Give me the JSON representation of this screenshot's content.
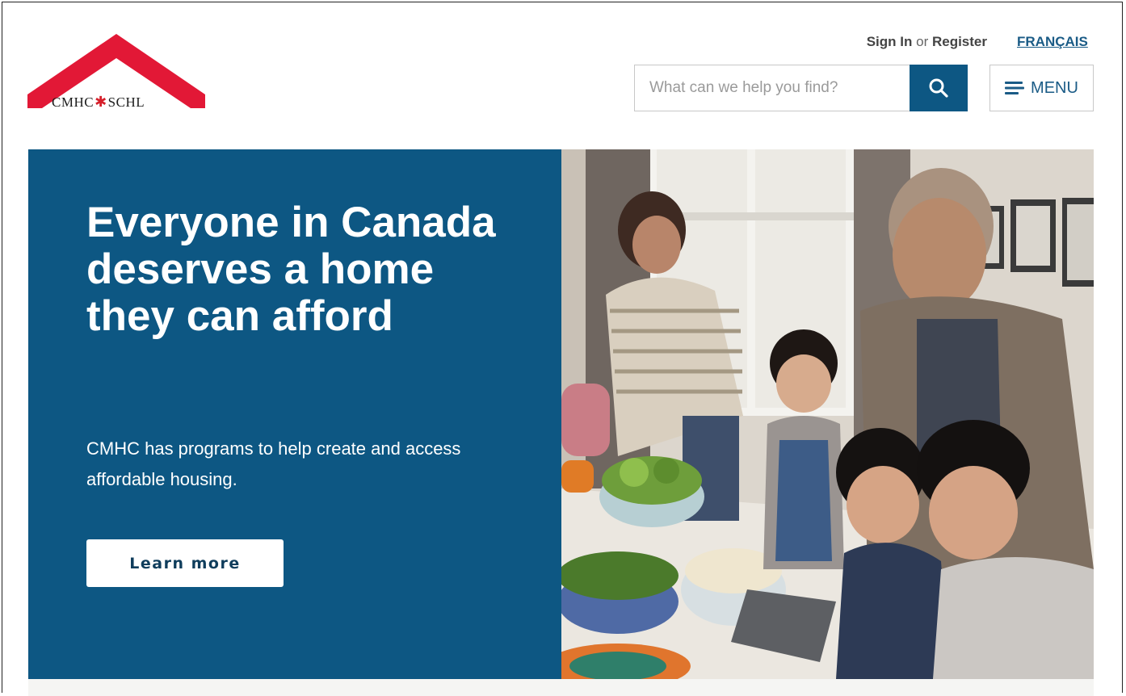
{
  "header": {
    "logo": {
      "en": "CMHC",
      "fr": "SCHL",
      "brand_color": "#e21836"
    },
    "sign_in": "Sign In",
    "or": "or",
    "register": "Register",
    "language": "FRANÇAIS",
    "search": {
      "placeholder": "What can we help you find?",
      "icon": "search-icon"
    },
    "menu": {
      "label": "MENU",
      "icon": "hamburger-menu-icon"
    }
  },
  "hero": {
    "title": "Everyone in Canada deserves a home they can afford",
    "text": "CMHC has programs to help create and access affordable housing.",
    "button": "Learn more",
    "background_color": "#0d5783"
  }
}
